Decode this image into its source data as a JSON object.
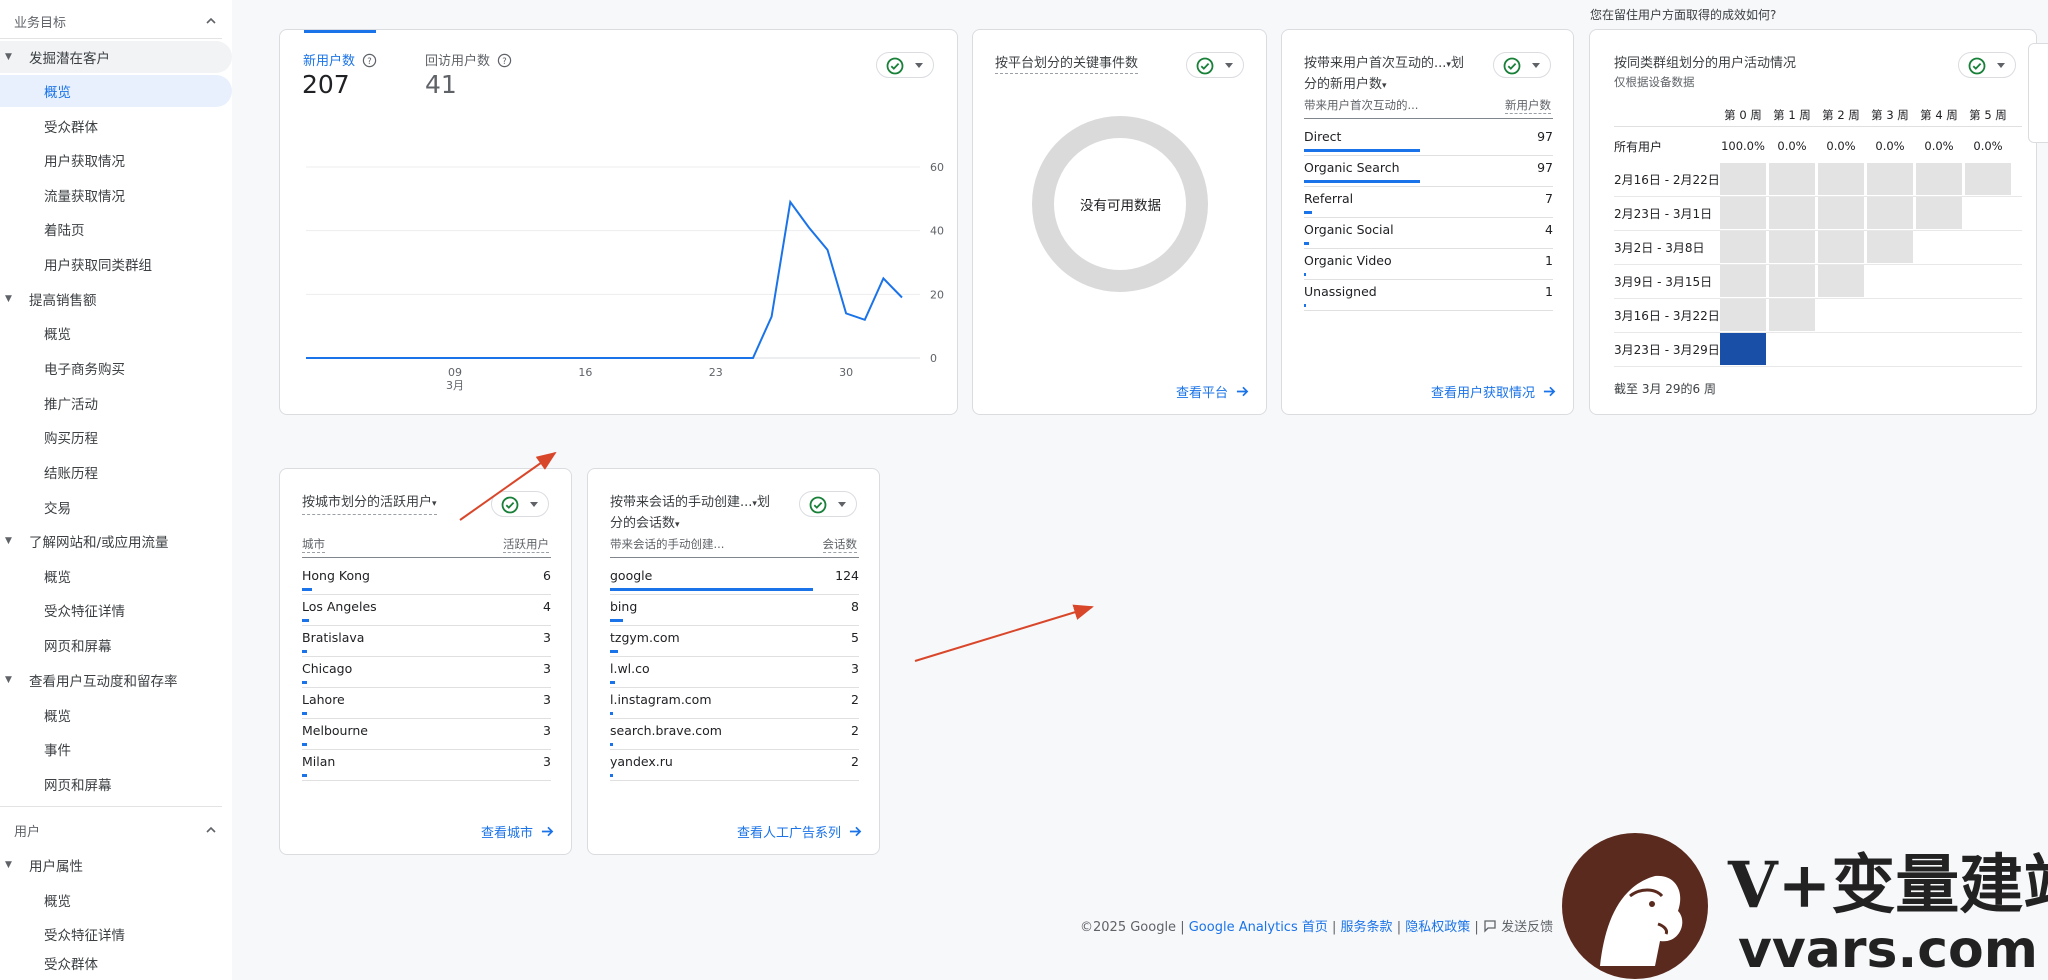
{
  "sidebar": {
    "section1": "业务目标",
    "groups": [
      {
        "label": "发掘潜在客户",
        "items": [
          "概览",
          "受众群体",
          "用户获取情况",
          "流量获取情况",
          "着陆页",
          "用户获取同类群组"
        ]
      },
      {
        "label": "提高销售额",
        "items": [
          "概览",
          "电子商务购买",
          "推广活动",
          "购买历程",
          "结账历程",
          "交易"
        ]
      },
      {
        "label": "了解网站和/或应用流量",
        "items": [
          "概览",
          "受众特征详情",
          "网页和屏幕"
        ]
      },
      {
        "label": "查看用户互动度和留存率",
        "items": [
          "概览",
          "事件",
          "网页和屏幕"
        ]
      }
    ],
    "section2": "用户",
    "groups2": [
      {
        "label": "用户属性",
        "items": [
          "概览",
          "受众特征详情",
          "受众群体"
        ]
      }
    ]
  },
  "top_question": "您在留住用户方面取得的成效如何?",
  "users_card": {
    "new_users_label": "新用户数",
    "new_users_value": "207",
    "returning_label": "回访用户数",
    "returning_value": "41",
    "x_ticks": [
      {
        "day": "09",
        "month": "3月"
      },
      {
        "day": "16",
        "month": ""
      },
      {
        "day": "23",
        "month": ""
      },
      {
        "day": "30",
        "month": ""
      }
    ]
  },
  "chart_data": {
    "type": "line",
    "title": "",
    "xlabel": "",
    "ylabel": "",
    "ylim": [
      0,
      60
    ],
    "yticks": [
      "0",
      "20",
      "40",
      "60"
    ],
    "series": [
      {
        "name": "新用户数",
        "x": [
          "3月1日",
          "3月2日",
          "3月3日",
          "3月4日",
          "3月5日",
          "3月6日",
          "3月7日",
          "3月8日",
          "3月9日",
          "3月10日",
          "3月11日",
          "3月12日",
          "3月13日",
          "3月14日",
          "3月15日",
          "3月16日",
          "3月17日",
          "3月18日",
          "3月19日",
          "3月20日",
          "3月21日",
          "3月22日",
          "3月23日",
          "3月24日",
          "3月25日",
          "3月26日",
          "3月27日",
          "3月28日",
          "3月29日",
          "3月30日",
          "3月31日",
          "4月1日",
          "4月2日"
        ],
        "values": [
          0,
          0,
          0,
          0,
          0,
          0,
          0,
          0,
          0,
          0,
          0,
          0,
          0,
          0,
          0,
          0,
          0,
          0,
          0,
          0,
          0,
          0,
          0,
          0,
          0,
          13,
          49,
          41,
          34,
          14,
          12,
          25,
          19
        ]
      }
    ]
  },
  "platform_card": {
    "title": "按平台划分的关键事件数",
    "no_data": "没有可用数据",
    "link": "查看平台"
  },
  "acquisition_card": {
    "title_line1": "按带来用户首次互动的...",
    "title_line2": "分的新用户数",
    "col1": "带来用户首次互动的...",
    "col2": "新用户数",
    "rows": [
      {
        "name": "Direct",
        "value": "97",
        "ratio": 1.0
      },
      {
        "name": "Organic Search",
        "value": "97",
        "ratio": 1.0
      },
      {
        "name": "Referral",
        "value": "7",
        "ratio": 0.07
      },
      {
        "name": "Organic Social",
        "value": "4",
        "ratio": 0.04
      },
      {
        "name": "Organic Video",
        "value": "1",
        "ratio": 0.01
      },
      {
        "name": "Unassigned",
        "value": "1",
        "ratio": 0.01
      }
    ],
    "link": "查看用户获取情况"
  },
  "cohort_card": {
    "title": "按同类群组划分的用户活动情况",
    "subtitle": "仅根据设备数据",
    "weeks": [
      "第 0 周",
      "第 1 周",
      "第 2 周",
      "第 3 周",
      "第 4 周",
      "第 5 周"
    ],
    "all_users_label": "所有用户",
    "all_users_pcts": [
      "100.0%",
      "0.0%",
      "0.0%",
      "0.0%",
      "0.0%",
      "0.0%"
    ],
    "rows": [
      {
        "label": "2月16日 - 2月22日",
        "cells": 6
      },
      {
        "label": "2月23日 - 3月1日",
        "cells": 5
      },
      {
        "label": "3月2日 - 3月8日",
        "cells": 4
      },
      {
        "label": "3月9日 - 3月15日",
        "cells": 3
      },
      {
        "label": "3月16日 - 3月22日",
        "cells": 2
      },
      {
        "label": "3月23日 - 3月29日",
        "cells": 1
      }
    ],
    "footer": "截至 3月 29的6 周"
  },
  "city_card": {
    "title": "按城市划分的活跃用户",
    "col1": "城市",
    "col2": "活跃用户",
    "rows": [
      {
        "name": "Hong Kong",
        "value": "6",
        "ratio": 1.0
      },
      {
        "name": "Los Angeles",
        "value": "4",
        "ratio": 0.67
      },
      {
        "name": "Bratislava",
        "value": "3",
        "ratio": 0.5
      },
      {
        "name": "Chicago",
        "value": "3",
        "ratio": 0.5
      },
      {
        "name": "Lahore",
        "value": "3",
        "ratio": 0.5
      },
      {
        "name": "Melbourne",
        "value": "3",
        "ratio": 0.5
      },
      {
        "name": "Milan",
        "value": "3",
        "ratio": 0.5
      }
    ],
    "link": "查看城市"
  },
  "session_card": {
    "title_line1": "按带来会话的手动创建...",
    "title_line2": "分的会话数",
    "col1": "带来会话的手动创建...",
    "col2": "会话数",
    "rows": [
      {
        "name": "google",
        "value": "124",
        "ratio": 1.0
      },
      {
        "name": "bing",
        "value": "8",
        "ratio": 0.065
      },
      {
        "name": "tzgym.com",
        "value": "5",
        "ratio": 0.04
      },
      {
        "name": "l.wl.co",
        "value": "3",
        "ratio": 0.024
      },
      {
        "name": "l.instagram.com",
        "value": "2",
        "ratio": 0.016
      },
      {
        "name": "search.brave.com",
        "value": "2",
        "ratio": 0.016
      },
      {
        "name": "yandex.ru",
        "value": "2",
        "ratio": 0.016
      }
    ],
    "link": "查看人工广告系列"
  },
  "footer": {
    "copyright": "©2025 Google |",
    "home": "Google Analytics 首页",
    "terms": "服务条款",
    "privacy": "隐私权政策",
    "feedback": "发送反馈",
    "sep": "|"
  },
  "watermark": {
    "brand": "V+变量建站",
    "domain": "vvars.com"
  },
  "colors": {
    "accent": "#1a73e8",
    "arrow": "#d9472b",
    "check": "#188038",
    "cohort_active": "#1a4fa8"
  }
}
